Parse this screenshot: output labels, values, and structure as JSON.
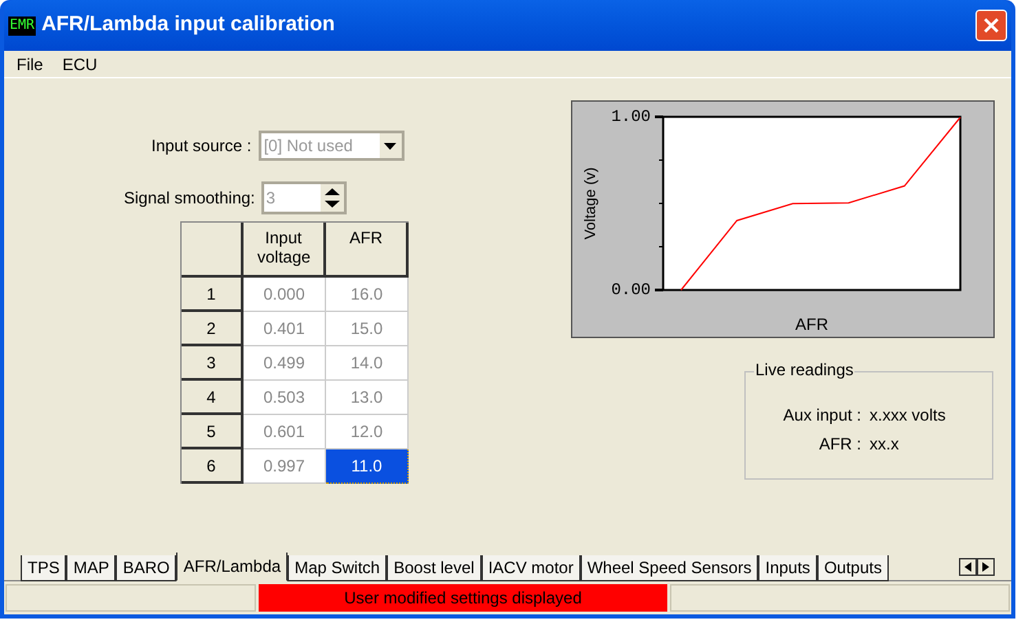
{
  "window": {
    "icon_text": "EMR",
    "title": "AFR/Lambda input calibration"
  },
  "menu": [
    "File",
    "ECU"
  ],
  "input_source": {
    "label": "Input source :",
    "value": "[0]  Not used",
    "disabled": true
  },
  "signal_smoothing": {
    "label": "Signal smoothing:",
    "value": "3",
    "disabled": true
  },
  "table": {
    "columns": [
      "",
      "Input voltage",
      "AFR"
    ],
    "rows": [
      {
        "index": "1",
        "voltage": "0.000",
        "afr": "16.0",
        "selected": false
      },
      {
        "index": "2",
        "voltage": "0.401",
        "afr": "15.0",
        "selected": false
      },
      {
        "index": "3",
        "voltage": "0.499",
        "afr": "14.0",
        "selected": false
      },
      {
        "index": "4",
        "voltage": "0.503",
        "afr": "13.0",
        "selected": false
      },
      {
        "index": "5",
        "voltage": "0.601",
        "afr": "12.0",
        "selected": false
      },
      {
        "index": "6",
        "voltage": "0.997",
        "afr": "11.0",
        "selected": true
      }
    ]
  },
  "chart": {
    "chart_data": {
      "type": "line",
      "xlabel": "AFR",
      "ylabel": "Voltage (v)",
      "series": [
        {
          "color": "#ff0000",
          "values": [
            0.0,
            0.401,
            0.499,
            0.503,
            0.601,
            0.997
          ]
        }
      ],
      "ylim": [
        0,
        1
      ],
      "yticks": [
        {
          "value": 0,
          "label": "0.00"
        },
        {
          "value": 1,
          "label": "1.00"
        }
      ]
    }
  },
  "live_readings": {
    "title": "Live readings",
    "items": [
      {
        "label": "Aux input :",
        "value": "x.xxx  volts"
      },
      {
        "label": "AFR :",
        "value": "xx.x"
      }
    ]
  },
  "tabs": [
    {
      "label": "TPS",
      "selected": false
    },
    {
      "label": "MAP",
      "selected": false
    },
    {
      "label": "BARO",
      "selected": false
    },
    {
      "label": "AFR/Lambda",
      "selected": true
    },
    {
      "label": "Map Switch",
      "selected": false
    },
    {
      "label": "Boost level",
      "selected": false
    },
    {
      "label": "IACV motor",
      "selected": false
    },
    {
      "label": "Wheel Speed Sensors",
      "selected": false
    },
    {
      "label": "Inputs",
      "selected": false
    },
    {
      "label": "Outputs",
      "selected": false
    }
  ],
  "status_bar": {
    "message": "User modified settings displayed",
    "alert": true
  }
}
